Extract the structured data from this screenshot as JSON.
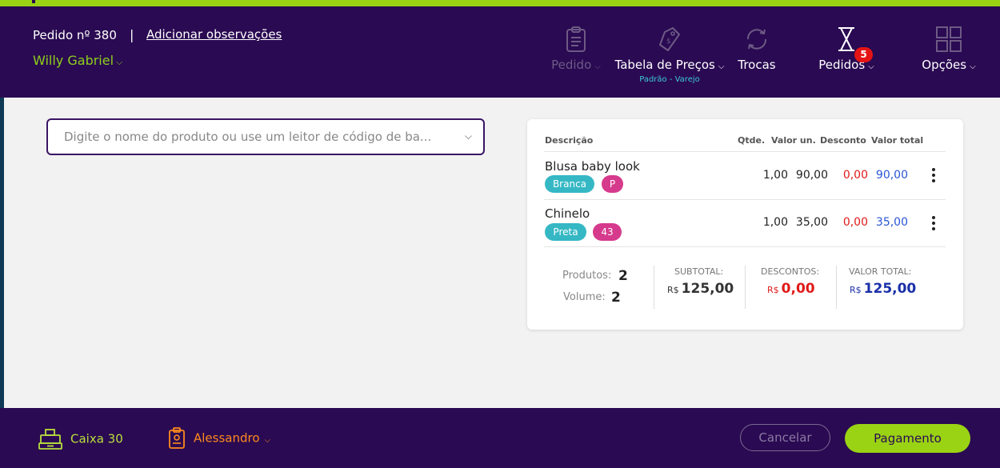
{
  "header": {
    "order_number": "Pedido nº 380",
    "separator": "|",
    "add_notes_link": "Adicionar observações",
    "customer_name": "Willy Gabriel",
    "nav": [
      {
        "label": "Pedido",
        "icon": "clipboard-icon",
        "enabled": false
      },
      {
        "label": "Tabela de Preços",
        "icon": "price-tag-icon",
        "sub": "Padrão - Varejo"
      },
      {
        "label": "Trocas",
        "icon": "exchange-icon"
      },
      {
        "label": "Pedidos",
        "icon": "hourglass-icon",
        "badge": "5"
      },
      {
        "label": "Opções",
        "icon": "grid-icon"
      }
    ]
  },
  "search": {
    "placeholder": "Digite o nome do produto ou use um leitor de código de ba..."
  },
  "cart": {
    "columns": [
      "Descrição",
      "Qtde.",
      "Valor un.",
      "Desconto",
      "Valor total"
    ],
    "items": [
      {
        "name": "Blusa baby look",
        "color": "Branca",
        "size": "P",
        "qty": "1,00",
        "unit": "90,00",
        "discount": "0,00",
        "total": "90,00"
      },
      {
        "name": "Chinelo",
        "color": "Preta",
        "size": "43",
        "qty": "1,00",
        "unit": "35,00",
        "discount": "0,00",
        "total": "35,00"
      }
    ],
    "summary": {
      "products_label": "Produtos:",
      "products": "2",
      "volume_label": "Volume:",
      "volume": "2",
      "subtotal_label": "SUBTOTAL:",
      "subtotal": "125,00",
      "discounts_label": "DESCONTOS:",
      "discounts": "0,00",
      "total_label": "VALOR TOTAL:",
      "total": "125,00",
      "currency": "R$"
    }
  },
  "footer": {
    "register": "Caixa 30",
    "seller": "Alessandro",
    "cancel": "Cancelar",
    "pay": "Pagamento"
  },
  "colors": {
    "header_bg": "#2a0a52",
    "accent_green": "#9ad314",
    "tag_color": "#35b8c4",
    "tag_size": "#d63a8c",
    "discount_red": "#e01a1a",
    "total_blue": "#2a55d6",
    "seller_orange": "#ff8a1c"
  }
}
